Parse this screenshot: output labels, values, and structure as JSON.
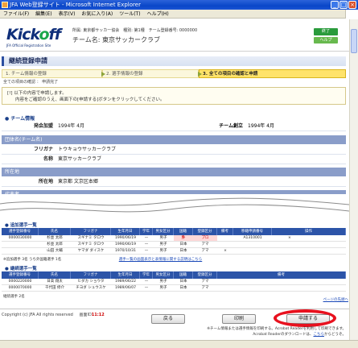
{
  "window": {
    "title": "JFA Web登録サイト - Microsoft Internet Explorer",
    "menu": [
      "ファイル(F)",
      "編集(E)",
      "表示(V)",
      "お気に入り(A)",
      "ツール(T)",
      "ヘルプ(H)"
    ]
  },
  "header": {
    "logo": "Kick",
    "logo_accent": "o",
    "logo_end": "ff",
    "logo_sub": "JFA Official Registration Site",
    "info": "所属: 東京都サッカー協会　種別: 第1種　チーム登録番号: 0000000",
    "team": "チーム名: 東京サッカークラブ",
    "btn_logout": "終了",
    "btn_help": "ヘルプ"
  },
  "page": {
    "title": "継続登録申請",
    "steps": [
      "1. チーム情報の登録",
      "2. 選手情報の登録",
      "3. 全ての項目の確認と申請"
    ],
    "step_note": "全ての項目の確認 ： 申請完了",
    "note_line1": "[!] 以下の内容で申請します。",
    "note_line2": "内容をご確認のうえ、画面下の[申請する]ボタンをクリックしてください。"
  },
  "team_info": {
    "heading": "● チーム情報",
    "founded_label": "発会加盟",
    "founded_value": "1994年 4月",
    "establish_label": "チーム創立",
    "establish_value": "1994年 4月",
    "name_bar": "団体名(チーム名)",
    "kana_label": "フリガナ",
    "kana_value": "トウキョウサッカークラブ",
    "name_label": "名称",
    "name_value": "東京サッカークラブ",
    "addr_bar": "所在地",
    "addr_label": "所在地",
    "addr_value": "東京都 文京区本郷",
    "rep_bar": "代表者"
  },
  "players": {
    "heading": "● 追加選手一覧",
    "headers": [
      "選手登録番号",
      "氏名",
      "フリガナ",
      "生年月日",
      "学年",
      "男女区分",
      "国籍",
      "登録区分",
      "備考",
      "移籍申請番号",
      "操作"
    ],
    "rows": [
      [
        "0000030000",
        "杉並 太郎",
        "スギナミ タロウ",
        "1990/06/19",
        "—",
        "男子",
        "外",
        "プロ",
        "",
        "A1310001",
        "×"
      ],
      [
        "",
        "杉並 太郎",
        "スギナミ タロウ",
        "1990/06/19",
        "—",
        "男子",
        "日本",
        "アマ",
        "",
        "",
        ""
      ],
      [
        "",
        "山田 大輔",
        "ヤマダ ダイスケ",
        "1970/10/31",
        "—",
        "男子",
        "日本",
        "アマ",
        "×",
        "",
        ""
      ]
    ],
    "legend": "※追加選手 3名 うち外国籍選手 1名",
    "legend_link": "選手一覧の画面表示と表情報に関する説明はこちら"
  },
  "existing": {
    "heading": "● 継続選手一覧",
    "headers": [
      "選手登録番号",
      "氏名",
      "フリガナ",
      "生年月日",
      "学年",
      "男女区分",
      "国籍",
      "登録区分",
      "備考"
    ],
    "rows": [
      [
        "0000220000",
        "日高 翔太",
        "ヒダカ ショウタ",
        "1989/06/22",
        "—",
        "男子",
        "日本",
        "アマ",
        ""
      ],
      [
        "0000070000",
        "千代田 修介",
        "チヨダ シュウスケ",
        "1989/06/07",
        "—",
        "男子",
        "日本",
        "アマ",
        ""
      ]
    ],
    "legend": "継続選手 2名",
    "to_list": "ページの先頭へ"
  },
  "footer": {
    "copyright": "Copyright (c) JFA All rights reserved",
    "time_label": "画面ID",
    "time_value": "11:12"
  },
  "actions": {
    "back": "戻る",
    "print": "印刷",
    "submit": "申請する",
    "note1": "※チーム情報または選手情報を印刷する。Acrobat Readerを利用して印刷できます。",
    "note2": "Acrobat Readerのダウンロードは、",
    "note2_link": "こちら",
    "note2_end": "からどうぞ。"
  }
}
